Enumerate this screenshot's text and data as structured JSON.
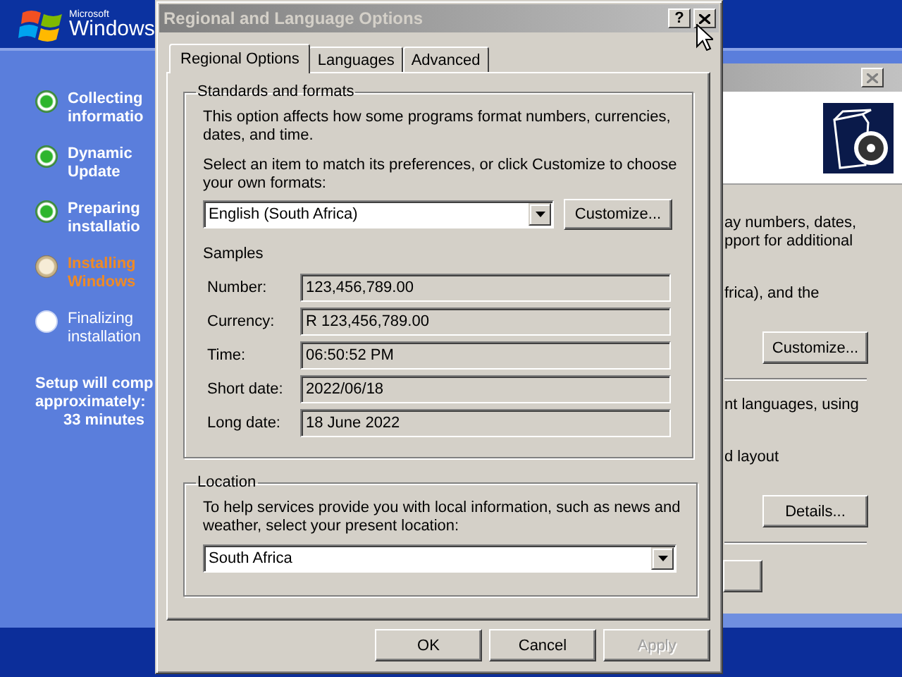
{
  "setup": {
    "logo_small": "Microsoft",
    "logo": "Windows",
    "steps": [
      {
        "lines": [
          "Collecting",
          "informatio"
        ],
        "completed": true,
        "active": false
      },
      {
        "lines": [
          "Dynamic",
          "Update"
        ],
        "completed": true,
        "active": false
      },
      {
        "lines": [
          "Preparing",
          "installatio"
        ],
        "completed": true,
        "active": false
      },
      {
        "lines": [
          "Installing",
          "Windows"
        ],
        "completed": false,
        "active": true
      },
      {
        "lines": [
          "Finalizing",
          "installation"
        ],
        "completed": false,
        "active": false
      }
    ],
    "estimate": [
      "Setup will comp",
      "approximately:",
      "33 minutes"
    ]
  },
  "back_window": {
    "sections": [
      {
        "texts": [
          [
            "ay numbers, dates,",
            "pport for additional"
          ],
          [
            "frica), and the"
          ]
        ],
        "button": "Customize..."
      },
      {
        "texts": [
          [
            "nt languages, using"
          ],
          [
            "d layout"
          ]
        ],
        "button": "Details..."
      }
    ]
  },
  "dialog": {
    "title": "Regional and Language Options",
    "active": false,
    "help_button": "?",
    "tabs": [
      {
        "label": "Regional Options",
        "selected": true
      },
      {
        "label": "Languages",
        "selected": false
      },
      {
        "label": "Advanced",
        "selected": false
      }
    ],
    "standards": {
      "legend": "Standards and formats",
      "description": [
        "This option affects how some programs format numbers, currencies,",
        "dates, and time."
      ],
      "prompt": [
        "Select an item to match its preferences, or click Customize to choose",
        "your own formats:"
      ],
      "format": "English (South Africa)",
      "customize_button": "Customize...",
      "samples_heading": "Samples",
      "samples": [
        {
          "label": "Number:",
          "value": "123,456,789.00"
        },
        {
          "label": "Currency:",
          "value": "R 123,456,789.00"
        },
        {
          "label": "Time:",
          "value": "06:50:52 PM"
        },
        {
          "label": "Short date:",
          "value": "2022/06/18"
        },
        {
          "label": "Long date:",
          "value": "18 June 2022"
        }
      ]
    },
    "location": {
      "legend": "Location",
      "description": [
        "To help services provide you with local information, such as news and",
        "weather, select your present location:"
      ],
      "value": "South Africa"
    },
    "buttons": [
      {
        "label": "OK",
        "disabled": false
      },
      {
        "label": "Cancel",
        "disabled": false
      },
      {
        "label": "Apply",
        "disabled": true
      }
    ]
  }
}
